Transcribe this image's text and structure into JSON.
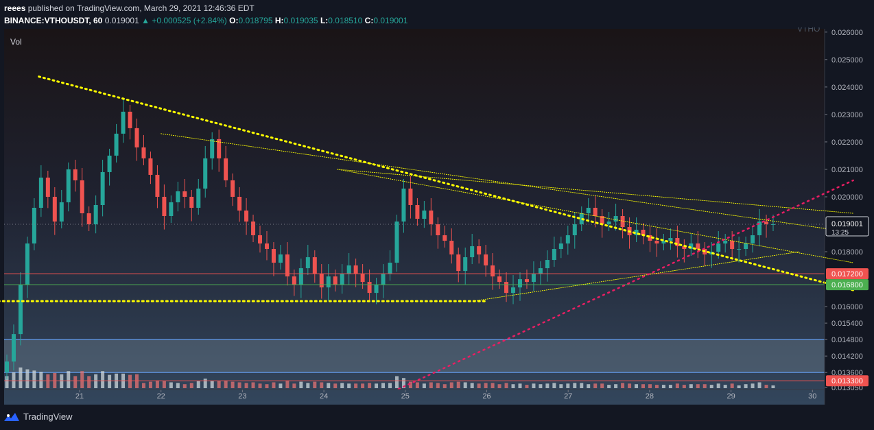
{
  "header": {
    "publisher_line_user": "reees",
    "publisher_line_rest": " published on TradingView.com, March 29, 2021 12:46:36 EDT",
    "symbol": "BINANCE:VTHOUSDT, 60",
    "last": "0.019001",
    "change": "+0.000525 (+2.84%)",
    "open_label": "O:",
    "open": "0.018795",
    "high_label": "H:",
    "high": "0.019035",
    "low_label": "L:",
    "low": "0.018510",
    "close_label": "C:",
    "close": "0.019001"
  },
  "panel": {
    "vol_label": "Vol",
    "watermark": "VTHO"
  },
  "footer": {
    "brand": "TradingView"
  },
  "colors": {
    "up": "#26a69a",
    "down": "#ef5350",
    "trend": "#ffff00",
    "trend_red": "#e91e63",
    "level_red": "#ef5350",
    "level_green": "#4caf50",
    "zone": "#5d6d7e"
  },
  "chart_data": {
    "type": "candlestick",
    "symbol": "BINANCE:VTHOUSDT",
    "interval": "60",
    "x_ticks": [
      "21",
      "22",
      "23",
      "24",
      "25",
      "26",
      "27",
      "28",
      "29",
      "30"
    ],
    "y_ticks": [
      "0.026000",
      "0.025000",
      "0.024000",
      "0.023000",
      "0.022000",
      "0.021000",
      "0.020000",
      "0.018000",
      "0.016000",
      "0.015400",
      "0.014800",
      "0.014200",
      "0.013600",
      "0.013050"
    ],
    "ylim": [
      0.01298,
      0.02612
    ],
    "last_price": {
      "value": 0.019001,
      "label": "0.019001",
      "countdown": "13:25"
    },
    "price_levels": [
      {
        "value": 0.0172,
        "label": "0.017200",
        "color": "#ef5350"
      },
      {
        "value": 0.0168,
        "label": "0.016800",
        "color": "#4caf50"
      },
      {
        "value": 0.0133,
        "label": "0.013300",
        "color": "#ef5350"
      }
    ],
    "zone": {
      "from": 0.0136,
      "to": 0.0148
    },
    "close_series": [
      0.014,
      0.015,
      0.0168,
      0.0183,
      0.0196,
      0.0207,
      0.02,
      0.0191,
      0.0198,
      0.021,
      0.0206,
      0.0194,
      0.019,
      0.0197,
      0.0209,
      0.0215,
      0.0223,
      0.0231,
      0.0225,
      0.0218,
      0.0214,
      0.0208,
      0.02,
      0.0193,
      0.0198,
      0.0202,
      0.02,
      0.0196,
      0.0203,
      0.0214,
      0.0221,
      0.0214,
      0.0206,
      0.02,
      0.0195,
      0.0191,
      0.0186,
      0.0183,
      0.0181,
      0.0176,
      0.0179,
      0.0171,
      0.0168,
      0.0174,
      0.0178,
      0.0172,
      0.0167,
      0.0171,
      0.0168,
      0.0172,
      0.0175,
      0.0172,
      0.0169,
      0.0165,
      0.0168,
      0.0172,
      0.0176,
      0.0191,
      0.0203,
      0.0197,
      0.0192,
      0.0195,
      0.019,
      0.0186,
      0.0184,
      0.0179,
      0.0173,
      0.0178,
      0.0182,
      0.0179,
      0.0175,
      0.0171,
      0.0169,
      0.0165,
      0.0167,
      0.017,
      0.0169,
      0.0172,
      0.0174,
      0.0177,
      0.0181,
      0.0183,
      0.0186,
      0.019,
      0.0194,
      0.0196,
      0.0193,
      0.019,
      0.0191,
      0.0193,
      0.0189,
      0.0186,
      0.0188,
      0.0186,
      0.0184,
      0.0183,
      0.0184,
      0.0185,
      0.0182,
      0.0181,
      0.0183,
      0.0181,
      0.0179,
      0.018,
      0.0183,
      0.0184,
      0.0181,
      0.0181,
      0.0183,
      0.0186,
      0.0191,
      0.019,
      0.019
    ],
    "trendlines": [
      {
        "label": "upper-dotted-descending",
        "from": [
          "20 12:00",
          0.02438
        ],
        "to": [
          "30 12:00",
          0.0166
        ]
      },
      {
        "label": "thin-descending-1",
        "from": [
          "22 00:00",
          0.0223
        ],
        "to": [
          "30 12:00",
          0.0187
        ]
      },
      {
        "label": "thin-descending-2",
        "from": [
          "24 04:00",
          0.021
        ],
        "to": [
          "30 12:00",
          0.0194
        ]
      },
      {
        "label": "thin-descending-3",
        "from": [
          "24 04:00",
          0.021
        ],
        "to": [
          "30 12:00",
          0.0176
        ]
      },
      {
        "label": "rising-support",
        "from": [
          "25 20:00",
          0.0162
        ],
        "to": [
          "29 20:00",
          0.018
        ]
      },
      {
        "label": "horizontal-support",
        "from": [
          "20 00:00",
          0.0162
        ],
        "to": [
          "26 00:00",
          0.0162
        ]
      },
      {
        "label": "red-dotted-rising",
        "from": [
          "24 22:00",
          0.013
        ],
        "to": [
          "30 12:00",
          0.0206
        ]
      }
    ]
  }
}
